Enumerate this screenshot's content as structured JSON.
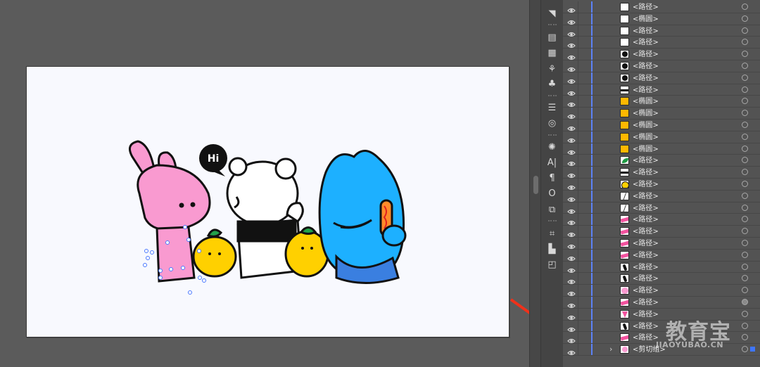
{
  "layers": [
    {
      "name": "<路径>",
      "thumb": "white",
      "target": "empty"
    },
    {
      "name": "<椭圆>",
      "thumb": "white",
      "target": "empty"
    },
    {
      "name": "<路径>",
      "thumb": "white",
      "target": "empty"
    },
    {
      "name": "<路径>",
      "thumb": "white",
      "target": "empty"
    },
    {
      "name": "<路径>",
      "thumb": "black-dot",
      "target": "empty"
    },
    {
      "name": "<路径>",
      "thumb": "black-dot",
      "target": "empty"
    },
    {
      "name": "<路径>",
      "thumb": "black-dot",
      "target": "empty"
    },
    {
      "name": "<路径>",
      "thumb": "black-band",
      "target": "empty"
    },
    {
      "name": "<椭圆>",
      "thumb": "yellow",
      "target": "empty"
    },
    {
      "name": "<椭圆>",
      "thumb": "yellow",
      "target": "empty"
    },
    {
      "name": "<椭圆>",
      "thumb": "yellow",
      "target": "empty"
    },
    {
      "name": "<椭圆>",
      "thumb": "yellow",
      "target": "empty"
    },
    {
      "name": "<椭圆>",
      "thumb": "yellow",
      "target": "empty"
    },
    {
      "name": "<路径>",
      "thumb": "green",
      "target": "empty"
    },
    {
      "name": "<路径>",
      "thumb": "black-band",
      "target": "empty"
    },
    {
      "name": "<路径>",
      "thumb": "yellow-dot",
      "target": "empty"
    },
    {
      "name": "<路径>",
      "thumb": "line",
      "target": "empty"
    },
    {
      "name": "<路径>",
      "thumb": "line",
      "target": "empty"
    },
    {
      "name": "<路径>",
      "thumb": "pink-band",
      "target": "empty"
    },
    {
      "name": "<路径>",
      "thumb": "pink-band",
      "target": "empty"
    },
    {
      "name": "<路径>",
      "thumb": "pink-band",
      "target": "empty"
    },
    {
      "name": "<路径>",
      "thumb": "pink-band",
      "target": "empty"
    },
    {
      "name": "<路径>",
      "thumb": "black-slash",
      "target": "empty"
    },
    {
      "name": "<路径>",
      "thumb": "black-slash",
      "target": "empty"
    },
    {
      "name": "<路径>",
      "thumb": "pink-blob",
      "target": "empty"
    },
    {
      "name": "<路径>",
      "thumb": "pink-band",
      "target": "filled"
    },
    {
      "name": "<路径>",
      "thumb": "pink-tri",
      "target": "empty"
    },
    {
      "name": "<路径>",
      "thumb": "black-slash",
      "target": "empty"
    },
    {
      "name": "<路径>",
      "thumb": "pink-band",
      "target": "empty"
    }
  ],
  "clip_group": {
    "name": "<剪切组>",
    "expander": "›"
  },
  "artwork": {
    "speech_bubble": "Hi"
  },
  "watermark": {
    "title": "教育宝",
    "url": "JIAOYUBAO.CN"
  },
  "icons": [
    "brush-icon",
    "shape-icon",
    "gradient-icon",
    "swatch-icon",
    "symbol-icon",
    "club-icon",
    "align-icon",
    "appearance-icon",
    "sun-icon",
    "character-icon",
    "paragraph-icon",
    "opentype-icon",
    "transform-icon",
    "grid-icon",
    "distribute-icon",
    "pathfinder-icon"
  ],
  "colors": {
    "accent": "#5c82f7",
    "pink": "#f99ad0",
    "yellow": "#ffd000",
    "blue": "#1db0ff",
    "arrow": "#f0311a"
  }
}
